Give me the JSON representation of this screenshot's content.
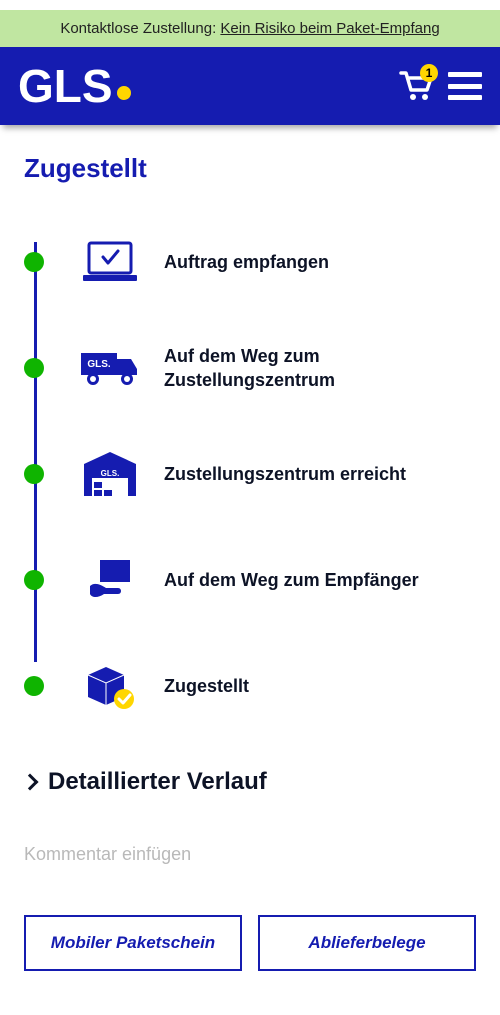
{
  "banner": {
    "prefix": "Kontaktlose Zustellung: ",
    "link_text": "Kein Risiko beim Paket-Empfang"
  },
  "header": {
    "logo_text": "GLS",
    "cart_count": "1"
  },
  "page_title": "Zugestellt",
  "steps": [
    {
      "label": "Auftrag empfangen"
    },
    {
      "label": "Auf dem Weg zum Zustellungszentrum"
    },
    {
      "label": "Zustellungszentrum erreicht"
    },
    {
      "label": "Auf dem Weg zum Empfänger"
    },
    {
      "label": "Zugestellt"
    }
  ],
  "expander_label": "Detaillierter Verlauf",
  "comment_placeholder": "Kommentar einfügen",
  "buttons": {
    "mobile_slip": "Mobiler Paketschein",
    "proof_delivery": "Ablieferbelege"
  }
}
